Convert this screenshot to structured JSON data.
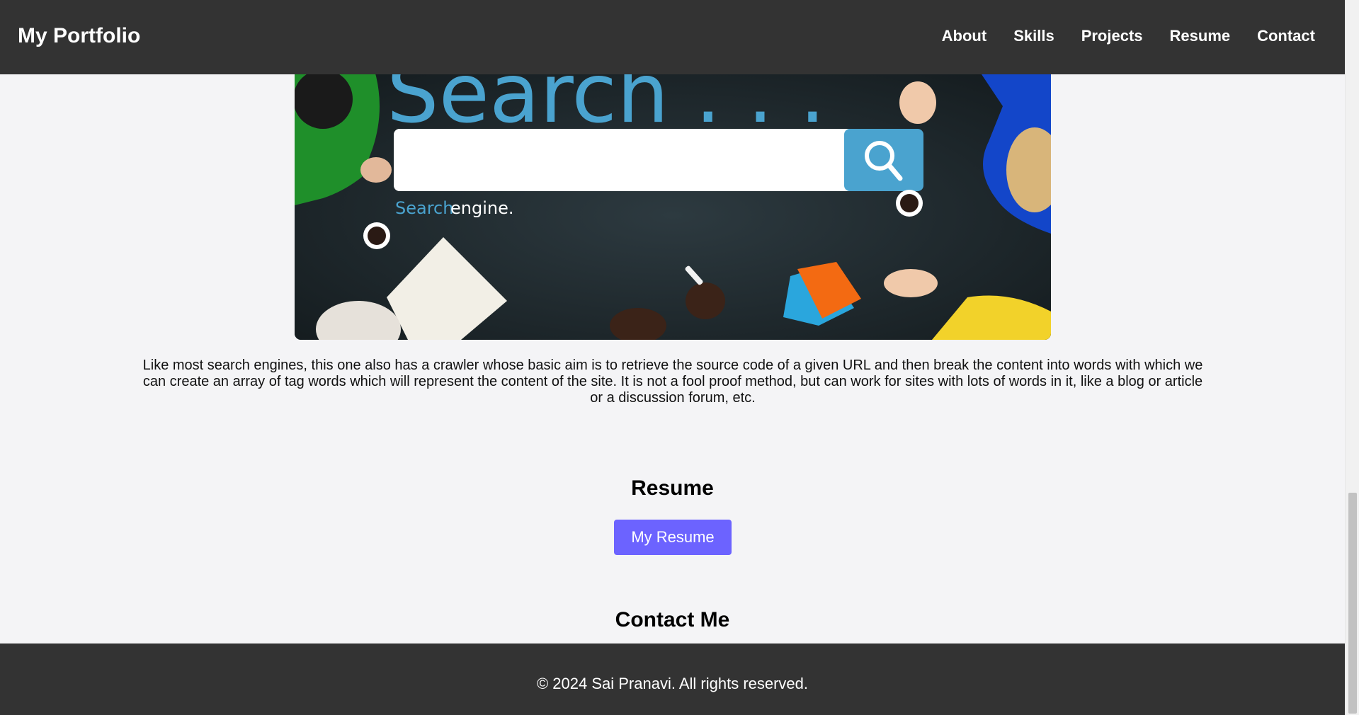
{
  "navbar": {
    "brand": "My Portfolio",
    "links": [
      "About",
      "Skills",
      "Projects",
      "Resume",
      "Contact"
    ]
  },
  "project": {
    "image": {
      "headline_text": "Search . . .",
      "caption_word_1": "Search",
      "caption_word_2": "engine."
    },
    "description": "Like most search engines, this one also has a crawler whose basic aim is to retrieve the source code of a given URL and then break the content into words with which we can create an array of tag words which will represent the content of the site. It is not a fool proof method, but can work for sites with lots of words in it, like a blog or article or a discussion forum, etc."
  },
  "resume": {
    "title": "Resume",
    "button_label": "My Resume"
  },
  "contact": {
    "title": "Contact Me"
  },
  "footer": {
    "copyright": "© 2024 Sai Pranavi. All rights reserved."
  },
  "colors": {
    "navbar_bg": "#333333",
    "page_bg": "#f4f4f6",
    "button_bg": "#6c63ff",
    "image_accent": "#4aa3cf"
  }
}
